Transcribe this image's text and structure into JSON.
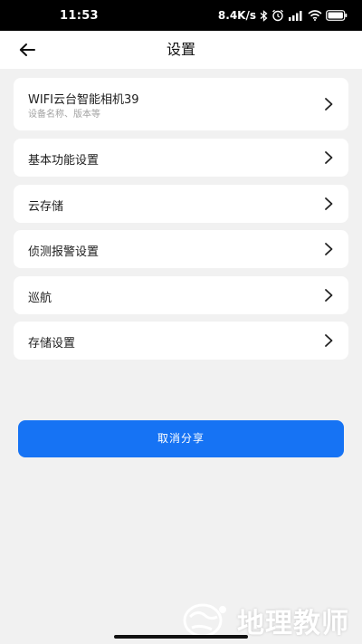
{
  "status_bar": {
    "time": "11:53",
    "network_speed": "8.4K/s",
    "icons": [
      "bluetooth-icon",
      "alarm-icon",
      "signal-icon",
      "wifi-icon",
      "battery-icon"
    ]
  },
  "header": {
    "title": "设置",
    "back_icon": "arrow-left-icon"
  },
  "settings": {
    "device": {
      "name": "WIFI云台智能相机39",
      "subtitle": "设备名称、版本等"
    },
    "items": [
      {
        "label": "基本功能设置"
      },
      {
        "label": "云存储"
      },
      {
        "label": "侦测报警设置"
      },
      {
        "label": "巡航"
      },
      {
        "label": "存储设置"
      }
    ]
  },
  "actions": {
    "cancel_share": "取消分享"
  },
  "watermark": {
    "text": "地理教师"
  },
  "colors": {
    "accent": "#1673f4",
    "background": "#f1f1f1",
    "card": "#ffffff"
  }
}
